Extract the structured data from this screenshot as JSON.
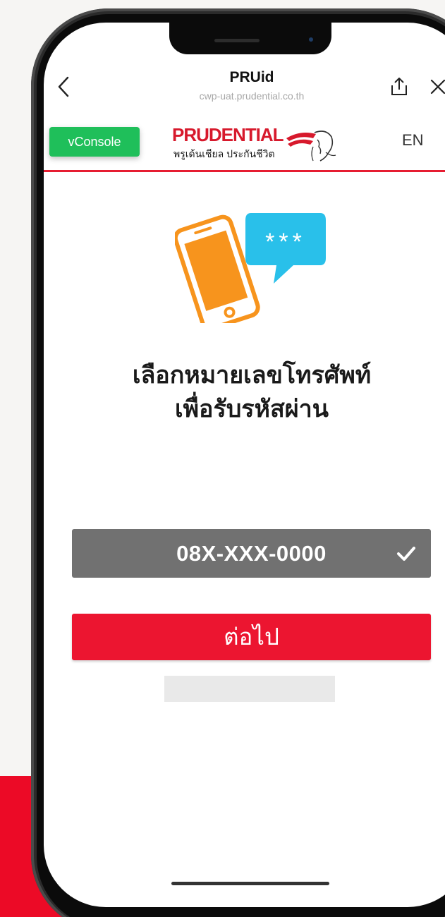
{
  "browser": {
    "title": "PRUid",
    "url": "cwp-uat.prudential.co.th"
  },
  "app_bar": {
    "vconsole_label": "vConsole",
    "logo_word": "PRUDENTIAL",
    "logo_thai": "พรูเด้นเชียล ประกันชีวิต",
    "language": "EN"
  },
  "illustration": {
    "bubble_text": "***",
    "phone_color": "#f7941d",
    "bubble_color": "#29c0ea"
  },
  "main": {
    "headline_line1": "เลือกหมายเลขโทรศัพท์",
    "headline_line2": "เพื่อรับรหัสผ่าน",
    "phone_number": "08X-XXX-0000",
    "next_label": "ต่อไป"
  },
  "colors": {
    "brand_red": "#ec1530",
    "select_gray": "#717171",
    "vconsole_green": "#1fbf5a"
  }
}
